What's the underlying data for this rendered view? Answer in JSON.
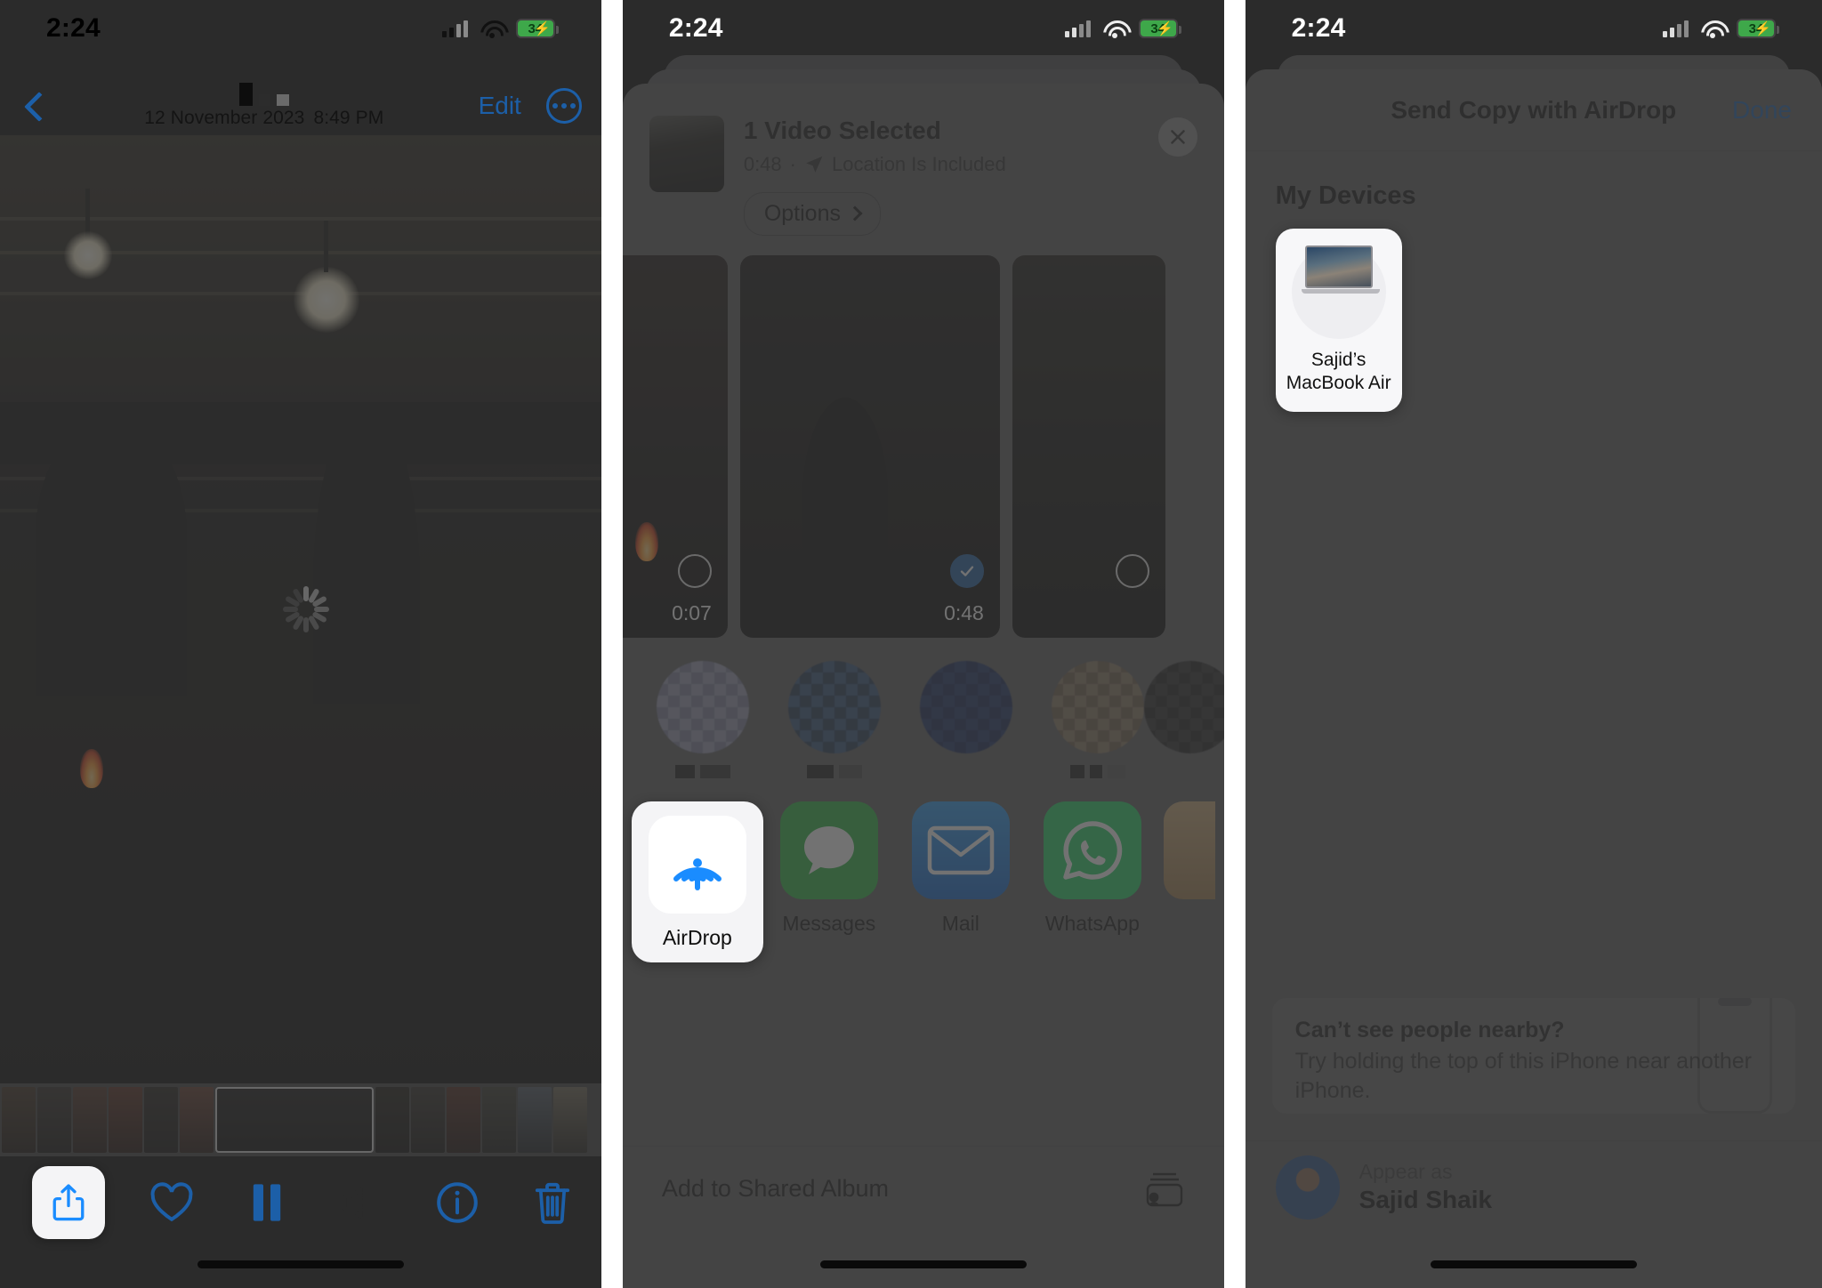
{
  "status_bar": {
    "time": "2:24",
    "battery_level": "34",
    "battery_charging": true,
    "icons": [
      "cellular-signal-icon",
      "wifi-icon",
      "battery-icon"
    ]
  },
  "panel1": {
    "name": "photos-video-viewer",
    "back_label": "Back",
    "title_date": "12 November 2023",
    "title_time": "8:49 PM",
    "edit_label": "Edit",
    "more_icon": "more-ellipsis-icon",
    "loading_icon": "activity-spinner-icon",
    "toolbar": [
      {
        "name": "share-button",
        "icon": "share-icon",
        "highlighted": true
      },
      {
        "name": "favorite-button",
        "icon": "heart-icon",
        "highlighted": false
      },
      {
        "name": "pause-button",
        "icon": "pause-icon",
        "highlighted": false
      },
      {
        "name": "mute-button",
        "icon": "speaker-mute-icon",
        "highlighted": false
      },
      {
        "name": "info-button",
        "icon": "info-circle-icon",
        "highlighted": false
      },
      {
        "name": "delete-button",
        "icon": "trash-icon",
        "highlighted": false
      }
    ]
  },
  "panel2": {
    "name": "share-sheet",
    "header_title": "1 Video Selected",
    "duration": "0:48",
    "separator": "·",
    "location_icon": "location-arrow-icon",
    "location_label": "Location Is Included",
    "options_label": "Options",
    "close_icon": "close-icon",
    "thumbnails": [
      {
        "duration": "0:07",
        "selected": false
      },
      {
        "duration": "0:48",
        "selected": true
      },
      {
        "duration": "",
        "selected": false
      }
    ],
    "apps": [
      {
        "label": "AirDrop",
        "icon": "airdrop-icon",
        "highlighted": true,
        "color": "#ffffff"
      },
      {
        "label": "Messages",
        "icon": "messages-icon",
        "highlighted": false,
        "color": "#2bb741"
      },
      {
        "label": "Mail",
        "icon": "mail-icon",
        "highlighted": false,
        "color": "#1c79d8"
      },
      {
        "label": "WhatsApp",
        "icon": "whatsapp-icon",
        "highlighted": false,
        "color": "#25d366"
      }
    ],
    "shared_album_label": "Add to Shared Album",
    "shared_album_icon": "shared-album-icon"
  },
  "panel3": {
    "name": "airdrop-sheet",
    "header_title": "Send Copy with AirDrop",
    "done_label": "Done",
    "section_title": "My Devices",
    "device": {
      "name_line1": "Sajid’s",
      "name_line2": "MacBook Air",
      "icon": "macbook-icon"
    },
    "hint_title": "Can’t see people nearby?",
    "hint_body": "Try holding the top of this iPhone near another iPhone.",
    "hint_icon": "iphone-outline-icon",
    "appear_label": "Appear as",
    "appear_name": "Sajid Shaik",
    "avatar_icon": "avatar"
  },
  "colors": {
    "accent_blue": "#1c5fa8",
    "selected_blue": "#1f5fa0",
    "battery_green": "#3ea84a",
    "sheet_gray": "#5a5a5c"
  }
}
